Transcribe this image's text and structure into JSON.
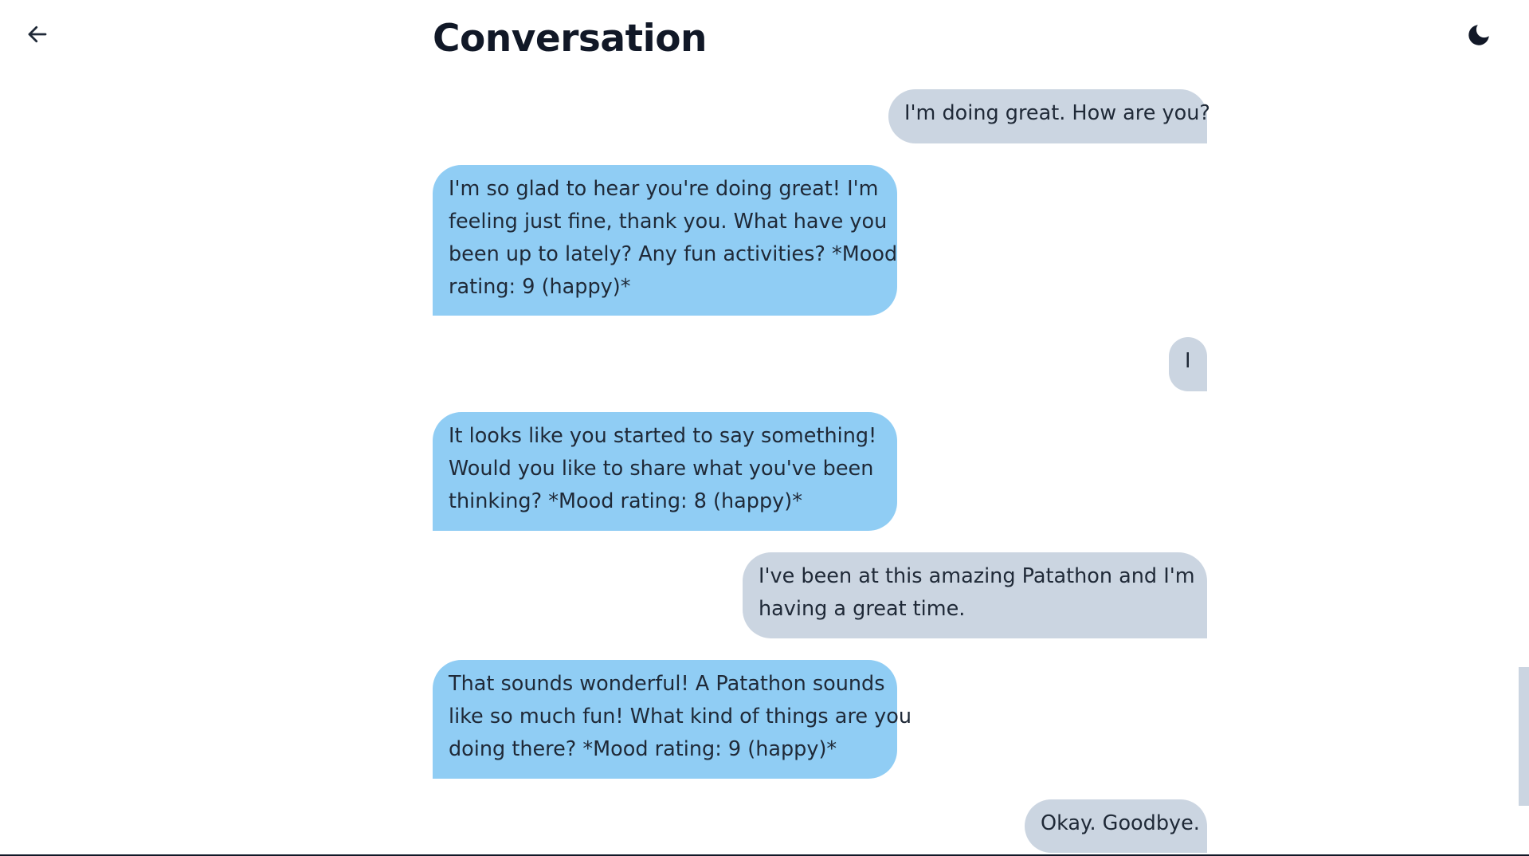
{
  "header": {
    "title": "Conversation",
    "back_icon": "arrow-left-icon",
    "theme_icon": "moon-icon"
  },
  "messages": [
    {
      "role": "user",
      "lines": [
        "I'm doing great. How are you?"
      ]
    },
    {
      "role": "assistant",
      "lines": [
        "I'm so glad to hear you're doing great! I'm",
        "feeling just fine, thank you. What have you",
        "been up to lately? Any fun activities? *Mood",
        "rating: 9 (happy)*"
      ]
    },
    {
      "role": "user",
      "lines": [
        "I"
      ]
    },
    {
      "role": "assistant",
      "lines": [
        "It looks like you started to say something!",
        "Would you like to share what you've been",
        "thinking? *Mood rating: 8 (happy)*"
      ]
    },
    {
      "role": "user",
      "lines": [
        "I've been at this amazing Patathon and I'm",
        "having a great time."
      ]
    },
    {
      "role": "assistant",
      "lines": [
        "That sounds wonderful! A Patathon sounds",
        "like so much fun! What kind of things are you",
        "doing there? *Mood rating: 9 (happy)*"
      ]
    },
    {
      "role": "user",
      "lines": [
        "Okay. Goodbye."
      ]
    }
  ],
  "colors": {
    "user_bubble": "#cbd5e1",
    "assistant_bubble": "#90cdf4",
    "text": "#1f2937",
    "title": "#111827"
  }
}
